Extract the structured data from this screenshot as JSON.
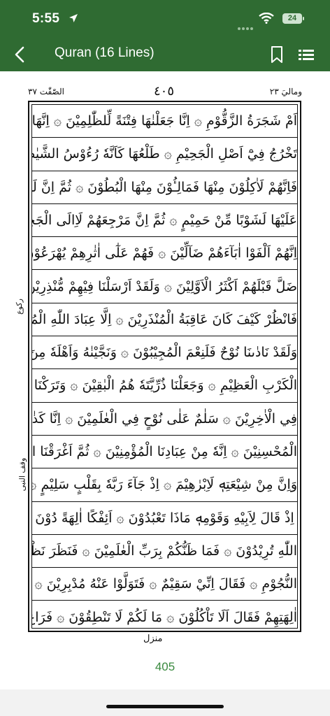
{
  "status_bar": {
    "time": "5:55",
    "battery": "24"
  },
  "header": {
    "title": "Quran (16 Lines)"
  },
  "page": {
    "header_left": "الصّٰفّٰت ٣٧",
    "header_center": "٤٠٥",
    "header_right": "وماليَ ٢٣",
    "side_top": "رکوع",
    "side_bottom": "وقف النبی",
    "manzil": "منزل",
    "number": "405",
    "lines": [
      "اَمْ شَجَرَةُ الزَّقُّوْمِ ۞ اِنَّا جَعَلْنٰهَا فِتْنَةً لِّلظّٰلِمِيْنَ ۞ اِنَّهَا شَجَرَةٌ",
      "تَخْرُجُ فِيْٓ اَصْلِ الْجَحِيْمِ ۞ طَلْعُهَا كَاَنَّهٗ رُءُوْسُ الشَّيٰطِيْنِ ۞",
      "فَاِنَّهُمْ لَاٰكِلُوْنَ مِنْهَا فَمَالِـُٔوْنَ مِنْهَا الْبُطُوْنَ ۞ ثُمَّ اِنَّ لَهُمْ",
      "عَلَيْهَا لَشَوْبًا مِّنْ حَمِيْمٍ ۞ ثُمَّ اِنَّ مَرْجِعَهُمْ لَاِالَى الْجَحِيْمِ ۞",
      "اِنَّهُمْ اَلْفَوْا اٰبَآءَهُمْ ضَآلِّيْنَ ۞ فَهُمْ عَلٰٓى اٰثٰرِهِمْ يُهْرَعُوْنَ ۞ وَلَقَدْ",
      "ضَلَّ قَبْلَهُمْ اَكْثَرُ الْاَوَّلِيْنَ ۞ وَلَقَدْ اَرْسَلْنَا فِيْهِمْ مُّنْذِرِيْنَ ۞",
      "فَانْظُرْ كَيْفَ كَانَ عَاقِبَةُ الْمُنْذَرِيْنَ ۞ اِلَّا عِبَادَ اللّٰهِ الْمُخْلَصِيْنَ ۞",
      "وَلَقَدْ نَادٰىنَا نُوْحٌ فَلَنِعْمَ الْمُجِيْبُوْنَ ۞ وَنَجَّيْنٰهُ وَاَهْلَهٗ مِنَ",
      "الْكَرْبِ الْعَظِيْمِ ۞ وَجَعَلْنَا ذُرِّيَّتَهٗ هُمُ الْبٰقِيْنَ ۞ وَتَرَكْنَا عَلَيْهِ",
      "فِي الْاٰخِرِيْنَ ۞ سَلٰمٌ عَلٰى نُوْحٍ فِي الْعٰلَمِيْنَ ۞ اِنَّا كَذٰلِكَ نَجْزِي",
      "الْمُحْسِنِيْنَ ۞ اِنَّهٗ مِنْ عِبَادِنَا الْمُؤْمِنِيْنَ ۞ ثُمَّ اَغْرَقْنَا الْاٰخَرِيْنَ ۞",
      "وَاِنَّ مِنْ شِيْعَتِهٖ لَاِبْرٰهِيْمَ ۞ اِذْ جَآءَ رَبَّهٗ بِقَلْبٍ سَلِيْمٍ ۞",
      "اِذْ قَالَ لِاَبِيْهِ وَقَوْمِهٖ مَاذَا تَعْبُدُوْنَ ۞ اَئِفْكًا اٰلِهَةً دُوْنَ",
      "اللّٰهِ تُرِيْدُوْنَ ۞ فَمَا ظَنُّكُمْ بِرَبِّ الْعٰلَمِيْنَ ۞ فَنَظَرَ نَظْرَةً فِي",
      "النُّجُوْمِ ۞ فَقَالَ اِنِّيْ سَقِيْمٌ ۞ فَتَوَلَّوْا عَنْهُ مُدْبِرِيْنَ ۞ فَرَاغَ اِلٰٓى",
      "اٰلِهَتِهِمْ فَقَالَ اَلَا تَاْكُلُوْنَ ۞ مَا لَكُمْ لَا تَنْطِقُوْنَ ۞ فَرَاغَ عَلَيْهِمْ"
    ]
  },
  "colors": {
    "header_bg": "#2f6b32",
    "page_number": "#3a8a3f"
  }
}
